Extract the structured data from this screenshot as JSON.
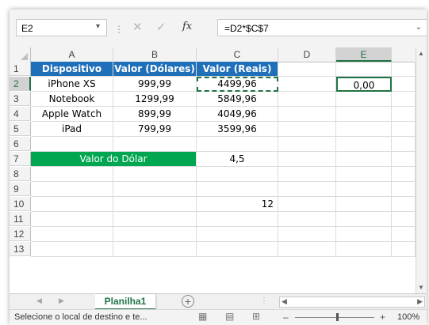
{
  "formula_bar": {
    "name_box": "E2",
    "name_box_arrow": "▾",
    "separator": "⋮",
    "cancel_icon": "✕",
    "enter_icon": "✓",
    "fx_label": "fx",
    "formula": "=D2*$C$7",
    "expand_icon": "⌄"
  },
  "columns": [
    "A",
    "B",
    "C",
    "D",
    "E"
  ],
  "selected_column": "E",
  "rows": [
    "1",
    "2",
    "3",
    "4",
    "5",
    "6",
    "7",
    "8",
    "9",
    "10",
    "11",
    "12",
    "13"
  ],
  "selected_row": "2",
  "table": {
    "headers": [
      "Dispositivo",
      "Valor (Dólares)",
      "Valor (Reais)"
    ],
    "items": [
      {
        "device": "iPhone XS",
        "usd": "999,99",
        "brl": "4499,96"
      },
      {
        "device": "Notebook",
        "usd": "1299,99",
        "brl": "5849,96"
      },
      {
        "device": "Apple Watch",
        "usd": "899,99",
        "brl": "4049,96"
      },
      {
        "device": "iPad",
        "usd": "799,99",
        "brl": "3599,96"
      }
    ],
    "dollar_label": "Valor do Dólar",
    "dollar_value": "4,5",
    "e2_value": "0,00",
    "c10_value": "12"
  },
  "sheet_tabs": {
    "prev_icon": "◀",
    "next_icon": "▶",
    "active_tab": "Planilha1",
    "add_icon": "+",
    "separator": "⋮"
  },
  "status_bar": {
    "message": "Selecione o local de destino e te...",
    "zoom_minus": "–",
    "zoom_plus": "+",
    "zoom": "100%"
  },
  "colors": {
    "header_blue": "#1f6fb9",
    "accent_green": "#00a650",
    "excel_green": "#217346"
  }
}
